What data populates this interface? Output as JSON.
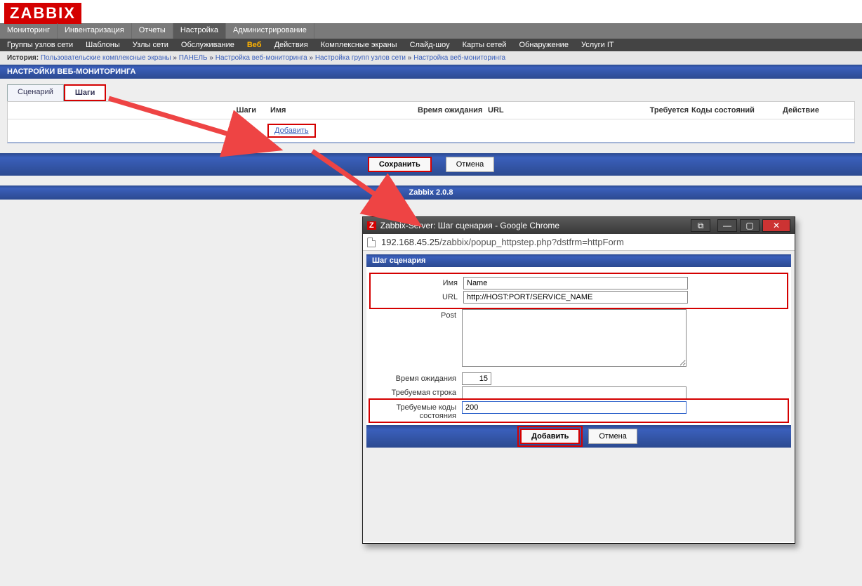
{
  "logo": "ZABBIX",
  "nav1": [
    "Мониторинг",
    "Инвентаризация",
    "Отчеты",
    "Настройка",
    "Администрирование"
  ],
  "nav1_active": 3,
  "nav2": [
    "Группы узлов сети",
    "Шаблоны",
    "Узлы сети",
    "Обслуживание",
    "Веб",
    "Действия",
    "Комплексные экраны",
    "Слайд-шоу",
    "Карты сетей",
    "Обнаружение",
    "Услуги IT"
  ],
  "nav2_active": 4,
  "history": {
    "label": "История:",
    "items": [
      "Пользовательские комплексные экраны",
      "ПАНЕЛЬ",
      "Настройка веб-мониторинга",
      "Настройка групп узлов сети",
      "Настройка веб-мониторинга"
    ]
  },
  "page_title": "НАСТРОЙКИ ВЕБ-МОНИТОРИНГА",
  "tabs": {
    "scenario": "Сценарий",
    "steps": "Шаги"
  },
  "table": {
    "steps_header": "Шаги",
    "name": "Имя",
    "wait": "Время ожидания",
    "url": "URL",
    "required": "Требуется",
    "codes": "Коды состояний",
    "action": "Действие",
    "add": "Добавить"
  },
  "buttons": {
    "save": "Сохранить",
    "cancel": "Отмена"
  },
  "footer": "Zabbix 2.0.8",
  "popup": {
    "title": "Zabbix-Server: Шаг сценария - Google Chrome",
    "url_host": "192.168.45.25",
    "url_path": "/zabbix/popup_httpstep.php?dstfrm=httpForm",
    "bar_title": "Шаг сценария",
    "labels": {
      "name": "Имя",
      "url": "URL",
      "post": "Post",
      "timeout": "Время ожидания",
      "required": "Требуемая строка",
      "codes": "Требуемые коды состояния"
    },
    "values": {
      "name": "Name",
      "url": "http://HOST:PORT/SERVICE_NAME",
      "post": "",
      "timeout": "15",
      "required": "",
      "codes": "200"
    },
    "buttons": {
      "add": "Добавить",
      "cancel": "Отмена"
    }
  }
}
